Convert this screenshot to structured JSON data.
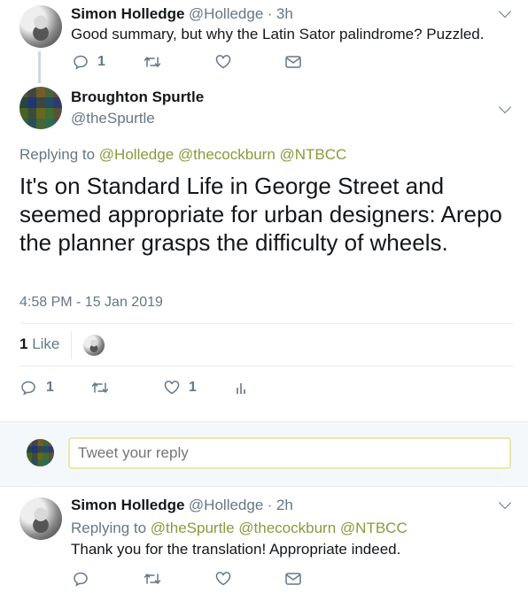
{
  "tweet1": {
    "name": "Simon Holledge",
    "handle": "@Holledge",
    "time": "3h",
    "text": "Good summary, but why the Latin Sator palindrome? Puzzled.",
    "reply_count": "1"
  },
  "main_tweet": {
    "name": "Broughton Spurtle",
    "handle": "@theSpurtle",
    "replying_prefix": "Replying to",
    "replying_to": [
      "@Holledge",
      "@thecockburn",
      "@NTBCC"
    ],
    "text": "It's on Standard Life in George Street and seemed appropriate for urban designers: Arepo the planner grasps the difficulty of wheels.",
    "timestamp": "4:58 PM - 15 Jan 2019",
    "likes_count": "1",
    "likes_label": "Like",
    "reply_count": "1",
    "like_count": "1"
  },
  "reply_box": {
    "placeholder": "Tweet your reply"
  },
  "tweet3": {
    "name": "Simon Holledge",
    "handle": "@Holledge",
    "time": "2h",
    "replying_prefix": "Replying to",
    "replying_to": [
      "@theSpurtle",
      "@thecockburn",
      "@NTBCC"
    ],
    "text": "Thank you for the translation! Appropriate indeed."
  },
  "colors": {
    "link_green": "#8a9a3a",
    "muted": "#657786",
    "border": "#e6ecf0"
  }
}
